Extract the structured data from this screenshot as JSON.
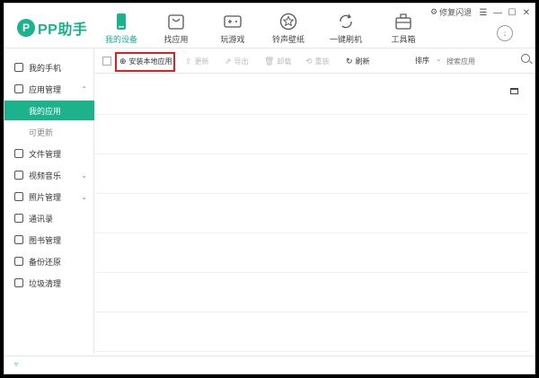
{
  "app": {
    "logo_letter": "P",
    "name": "PP助手",
    "brand_color": "#1bb28c"
  },
  "nav_tabs": [
    {
      "label": "我的设备",
      "icon": "phone-icon",
      "active": true
    },
    {
      "label": "找应用",
      "icon": "bag-icon",
      "active": false
    },
    {
      "label": "玩游戏",
      "icon": "gamepad-icon",
      "active": false
    },
    {
      "label": "铃声壁纸",
      "icon": "star-icon",
      "active": false
    },
    {
      "label": "一键刷机",
      "icon": "refresh-icon",
      "active": false
    },
    {
      "label": "工具箱",
      "icon": "toolbox-icon",
      "active": false
    }
  ],
  "window_controls": {
    "fix_label": "修复闪退",
    "menu": "☰",
    "minimize": "—",
    "maximize": "☐",
    "close": "✕"
  },
  "sidebar": {
    "items": [
      {
        "label": "我的手机",
        "icon": "phone-outline-icon"
      },
      {
        "label": "应用管理",
        "icon": "apps-icon",
        "chevron": "⌃"
      },
      {
        "label": "我的应用",
        "sub": true,
        "selected": true
      },
      {
        "label": "可更新",
        "sub": true
      },
      {
        "label": "文件管理",
        "icon": "file-icon"
      },
      {
        "label": "视频音乐",
        "icon": "video-icon",
        "chevron": "⌄"
      },
      {
        "label": "照片管理",
        "icon": "photo-icon",
        "chevron": "⌄"
      },
      {
        "label": "通讯录",
        "icon": "contacts-icon"
      },
      {
        "label": "图书管理",
        "icon": "book-icon"
      },
      {
        "label": "备份还原",
        "icon": "backup-icon"
      },
      {
        "label": "垃圾清理",
        "icon": "trash-icon"
      }
    ]
  },
  "toolbar": {
    "install_label": "安装本地应用",
    "update_label": "更新",
    "export_label": "导出",
    "uninstall_label": "卸载",
    "reinstall_label": "重装",
    "refresh_label": "刷新",
    "sort_label": "排序",
    "search_placeholder": "搜索应用"
  },
  "status": {
    "arrow": "▿"
  }
}
